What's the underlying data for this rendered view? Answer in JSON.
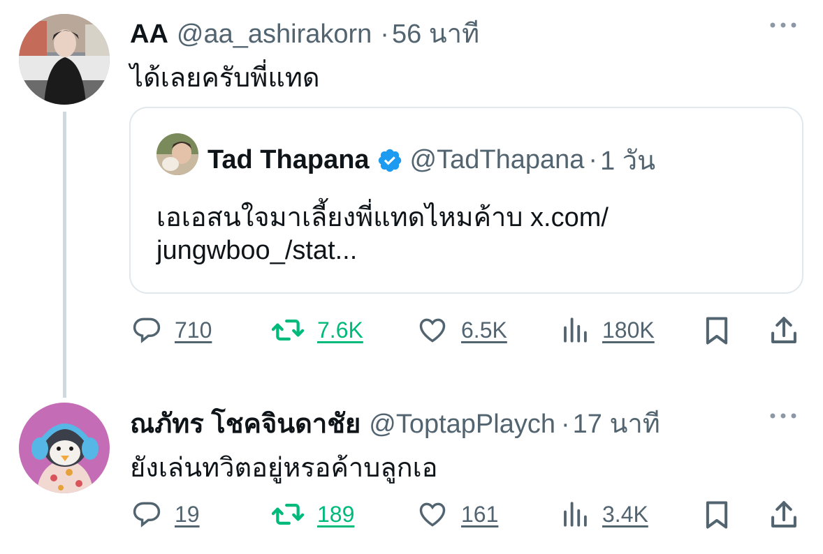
{
  "tweet1": {
    "display_name": "AA",
    "handle": "@aa_ashirakorn",
    "separator": "·",
    "time": "56 นาที",
    "text": "ได้เลยครับพี่แทด",
    "quote": {
      "display_name": "Tad Thapana",
      "verified": true,
      "handle": "@TadThapana",
      "separator": "·",
      "time": "1 วัน",
      "text_line1": "เอเอสนใจมาเลี้ยงพี่แทดไหมค้าบ x.com/",
      "text_line2": "jungwboo_/stat..."
    },
    "actions": {
      "replies": "710",
      "reposts": "7.6K",
      "likes": "6.5K",
      "views": "180K"
    }
  },
  "tweet2": {
    "display_name": "ณภัทร โชคจินดาชัย",
    "handle": "@ToptapPlaych",
    "separator": "·",
    "time": "17 นาที",
    "text": "ยังเล่นทวิตอยู่หรอค้าบลูกเอ",
    "actions": {
      "replies": "19",
      "reposts": "189",
      "likes": "161",
      "views": "3.4K"
    }
  },
  "icons": {
    "reply": "speech-bubble-icon",
    "repost": "repost-arrows-icon",
    "like": "heart-icon",
    "views": "bar-chart-icon",
    "bookmark": "bookmark-icon",
    "share": "share-upload-icon",
    "more": "ellipsis-icon",
    "verified": "verified-badge-icon"
  },
  "colors": {
    "text": "#0f1419",
    "secondary": "#536471",
    "repost_active": "#00ba7c",
    "verified": "#1d9bf0",
    "thread_line": "#cfd9de",
    "card_border": "#e1e8ed"
  }
}
